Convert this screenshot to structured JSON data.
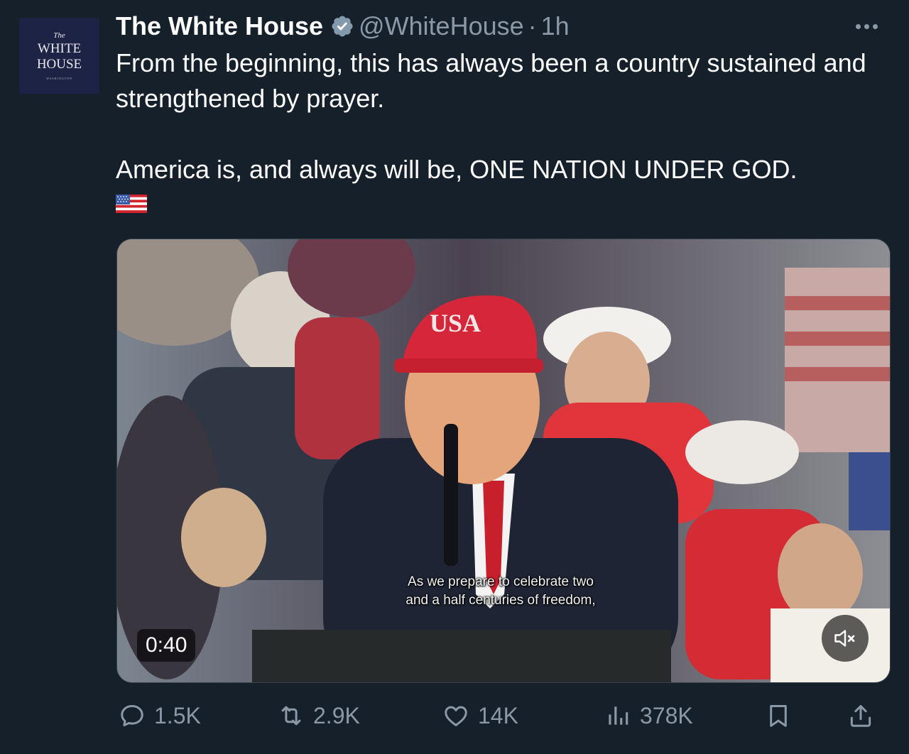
{
  "account": {
    "avatar": {
      "small_top": "The",
      "line1": "WHITE",
      "line2": "HOUSE",
      "tiny": "WASHINGTON"
    },
    "name": "The White House",
    "handle": "@WhiteHouse",
    "separator": "·",
    "time": "1h",
    "verified_badge_color": "#829aab"
  },
  "tweet": {
    "paragraph1": "From the beginning, this has always been a country sustained and strengthened by prayer.",
    "paragraph2": "America is, and always will be, ONE NATION UNDER GOD.",
    "emoji": "us-flag-emoji"
  },
  "video": {
    "hat_text": "USA",
    "subtitle_line1": "As we prepare to celebrate two",
    "subtitle_line2": "and a half centuries of freedom,",
    "duration": "0:40",
    "muted": true
  },
  "actions": {
    "replies": "1.5K",
    "reposts": "2.9K",
    "likes": "14K",
    "views": "378K"
  },
  "colors": {
    "background": "#15202b",
    "secondary_text": "#8b98a5",
    "primary_text": "#ffffff"
  }
}
